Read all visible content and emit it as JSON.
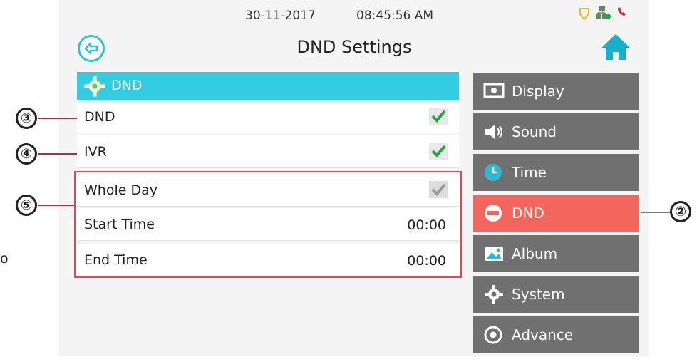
{
  "status": {
    "date": "30-11-2017",
    "time": "08:45:56 AM"
  },
  "header": {
    "title": "DND Settings"
  },
  "panel": {
    "header": "DND",
    "rows": [
      {
        "label": "DND",
        "checked": true
      },
      {
        "label": "IVR",
        "checked": true
      },
      {
        "label": "Whole Day",
        "checked": true,
        "disabled": true
      },
      {
        "label": "Start Time",
        "value": "00:00"
      },
      {
        "label": "End Time",
        "value": "00:00"
      }
    ]
  },
  "menu": [
    {
      "label": "Display",
      "icon": "display-icon"
    },
    {
      "label": "Sound",
      "icon": "speaker-icon"
    },
    {
      "label": "Time",
      "icon": "clock-icon"
    },
    {
      "label": "DND",
      "icon": "dnd-icon",
      "active": true
    },
    {
      "label": "Album",
      "icon": "image-icon"
    },
    {
      "label": "System",
      "icon": "gear-icon"
    },
    {
      "label": "Advance",
      "icon": "advance-icon"
    }
  ],
  "callouts": {
    "c2": "②",
    "c3": "③",
    "c4": "④",
    "c5": "⑤"
  },
  "margin_text": "o",
  "colors": {
    "accent": "#33cce0",
    "active": "#f2665d",
    "menu": "#707070",
    "check": "#27a547",
    "highlight_border": "#d84a54"
  }
}
